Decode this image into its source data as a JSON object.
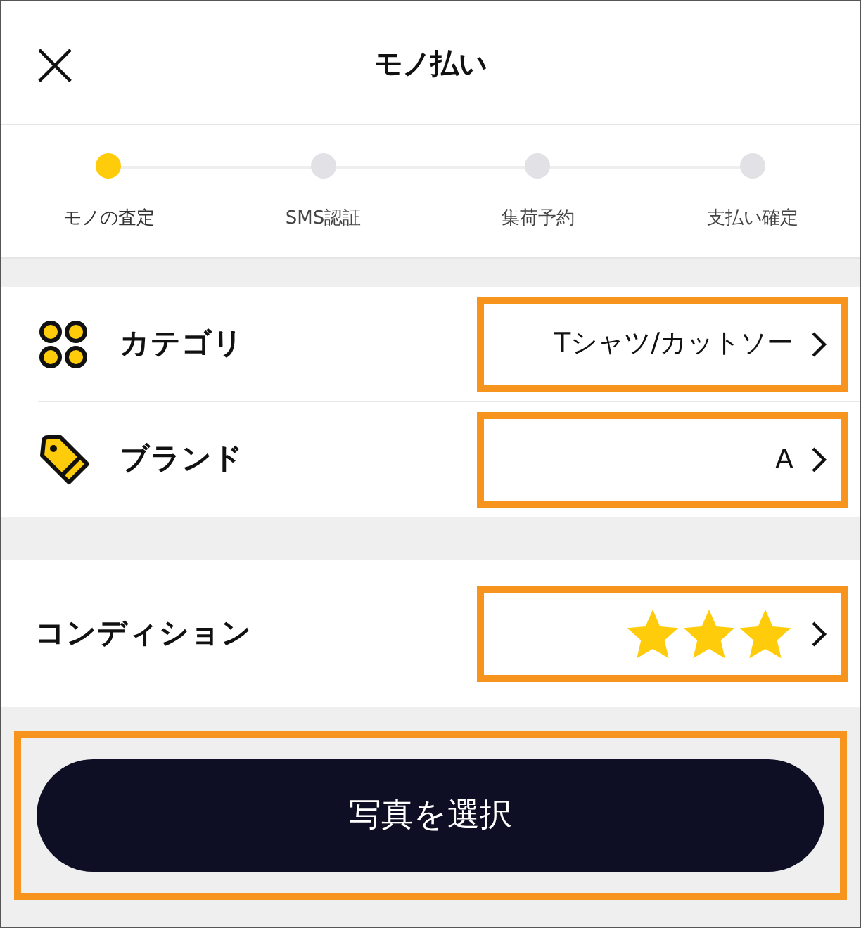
{
  "header": {
    "close": "×",
    "title": "モノ払い"
  },
  "steps": [
    {
      "label": "モノの査定",
      "selected": true
    },
    {
      "label": "SMS認証",
      "selected": false
    },
    {
      "label": "集荷予約",
      "selected": false
    },
    {
      "label": "支払い確定",
      "selected": false
    }
  ],
  "item_rows": [
    {
      "kind": "category",
      "label": "カテゴリ",
      "value": "Tシャツ/カットソー",
      "highlighted": true
    },
    {
      "kind": "brand",
      "label": "ブランド",
      "value": "A",
      "highlighted": true
    }
  ],
  "condition": {
    "label": "コンディション",
    "stars": 3,
    "highlighted": true
  },
  "action_button": {
    "label": "写真を選択",
    "highlighted": true
  }
}
